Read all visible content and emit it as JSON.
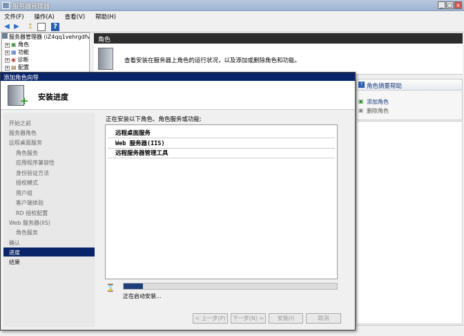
{
  "window": {
    "title": "服务器管理器",
    "minimize": "_",
    "maximize": "□",
    "close": "x"
  },
  "menu": [
    "文件(F)",
    "操作(A)",
    "查看(V)",
    "帮助(H)"
  ],
  "tree": {
    "root": "服务器管理器 (iZ4qq1vehrgdfv",
    "items": [
      "角色",
      "功能",
      "诊断",
      "配置"
    ]
  },
  "roles_panel": {
    "header": "角色",
    "description": "查看安装在服务器上角色的运行状况，以及添加或删除角色和功能。"
  },
  "actions_panel": {
    "help": "角色摘要帮助",
    "add_role": "添加角色",
    "remove_role": "删除角色"
  },
  "wizard": {
    "title": "添加角色向导",
    "heading": "安装进度",
    "nav": [
      {
        "label": "开始之前",
        "level": 0
      },
      {
        "label": "服务器角色",
        "level": 0
      },
      {
        "label": "远程桌面服务",
        "level": 0
      },
      {
        "label": "角色服务",
        "level": 1
      },
      {
        "label": "应用程序兼容性",
        "level": 1
      },
      {
        "label": "身份验证方法",
        "level": 1
      },
      {
        "label": "授权模式",
        "level": 1
      },
      {
        "label": "用户组",
        "level": 1
      },
      {
        "label": "客户端体验",
        "level": 1
      },
      {
        "label": "RD 授权配置",
        "level": 1
      },
      {
        "label": "Web 服务器(IIS)",
        "level": 0
      },
      {
        "label": "角色服务",
        "level": 1
      },
      {
        "label": "确认",
        "level": 0
      },
      {
        "label": "进度",
        "level": 0,
        "selected": true
      },
      {
        "label": "结果",
        "level": 0
      }
    ],
    "installing_label": "正在安装以下角色、角色服务或功能:",
    "installing_items": [
      "远程桌面服务",
      "Web 服务器(IIS)",
      "远程服务器管理工具"
    ],
    "progress_fraction": 0.09,
    "progress_text": "正在启动安装...",
    "buttons": {
      "prev": "< 上一步(P)",
      "next": "下一步(N) >",
      "install": "安装(I)",
      "cancel": "取消"
    }
  }
}
